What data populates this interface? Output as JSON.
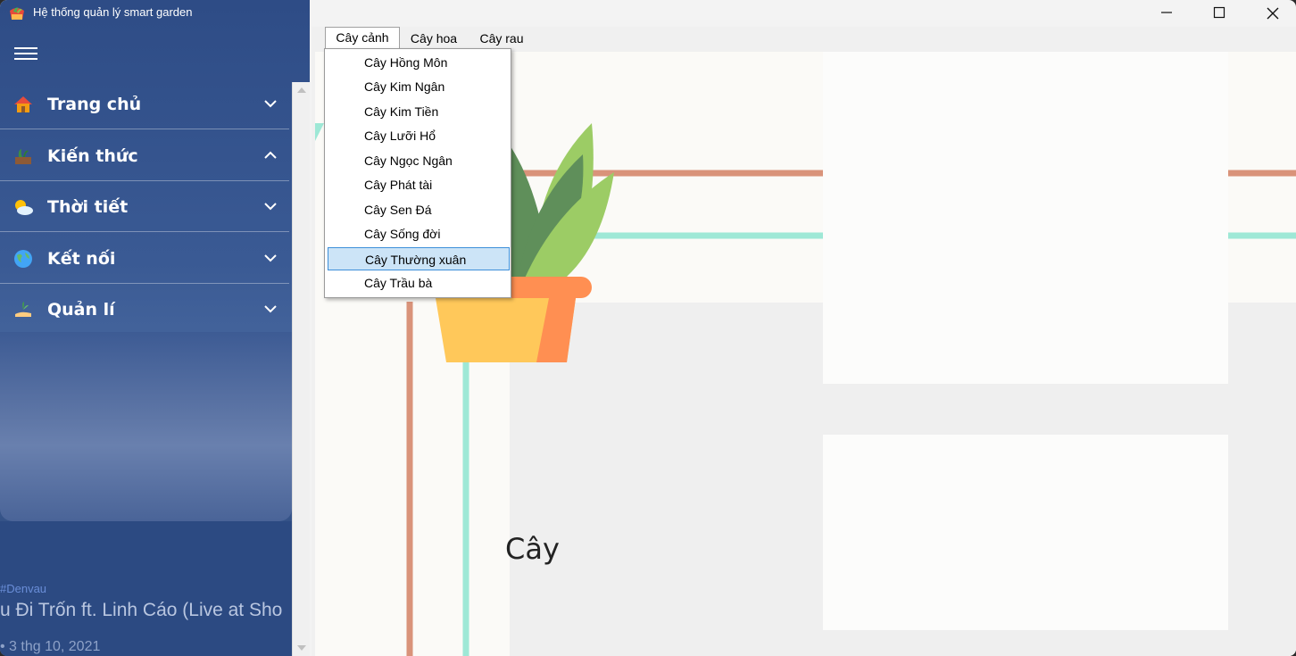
{
  "app": {
    "title": "Hệ thống quản lý smart garden"
  },
  "sidebar": {
    "items": [
      {
        "label": "Trang chủ",
        "icon": "home-icon",
        "expanded": false
      },
      {
        "label": "Kiến thức",
        "icon": "plant-box-icon",
        "expanded": true
      },
      {
        "label": "Thời tiết",
        "icon": "weather-icon",
        "expanded": false
      },
      {
        "label": "Kết nối",
        "icon": "globe-icon",
        "expanded": false
      },
      {
        "label": "Quản lí",
        "icon": "hand-plant-icon",
        "expanded": false
      }
    ]
  },
  "video": {
    "hashtag": "#Denvau",
    "title": "u Đi Trốn ft. Linh Cáo (Live at Sho",
    "date": "• 3 thg 10, 2021"
  },
  "tabs": [
    {
      "label": "Cây cảnh",
      "active": true
    },
    {
      "label": "Cây hoa",
      "active": false
    },
    {
      "label": "Cây rau",
      "active": false
    }
  ],
  "dropdown": {
    "items": [
      "Cây Hồng Môn",
      "Cây Kim Ngân",
      "Cây Kim Tiền",
      "Cây Lưỡi Hổ",
      "Cây Ngọc Ngân",
      "Cây Phát tài",
      "Cây Sen Đá",
      "Cây Sống đời",
      "Cây Thường xuân",
      "Cây Trầu bà"
    ],
    "selected": "Cây Thường xuân"
  },
  "scene": {
    "label": "Cây"
  },
  "colors": {
    "sidebar": "#2e4c86",
    "accent_orange": "#d9937a",
    "accent_teal": "#9ee8d6",
    "pot_yellow": "#ffc85a",
    "pot_orange": "#ff8f52",
    "leaf_dark": "#5f8f5a",
    "leaf_light": "#9ccc65",
    "selection": "#cce4f7"
  }
}
